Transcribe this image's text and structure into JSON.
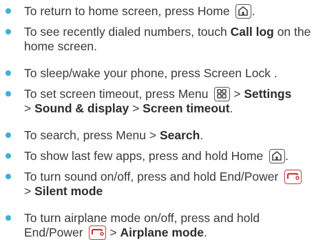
{
  "items": [
    {
      "t": "To return to home screen, press Home"
    },
    {
      "a": "To see recently dialed numbers, touch ",
      "b": "Call log",
      "c": " on the home screen."
    },
    {
      "t": "To sleep/wake your phone, press Screen Lock ."
    },
    {
      "a": "To set screen timeout, press Menu",
      "s1": " > ",
      "b1": "Settings",
      "l2": "> ",
      "b2": "Sound & display",
      "s2": " > ",
      "b3": "Screen timeout",
      "e": "."
    },
    {
      "a": "To search, press Menu > ",
      "b": "Search",
      "c": "."
    },
    {
      "t": "To show last few apps, press and hold Home"
    },
    {
      "a": "To turn sound on/off, press and hold End/Power",
      "l2": "> ",
      "b": "Silent mode"
    },
    {
      "a": "To turn airplane mode on/off, press and hold",
      "l2": "End/Power",
      "s": " > ",
      "b": "Airplane mode",
      "e": "."
    }
  ],
  "icons": {
    "home": "home-icon",
    "menu": "menu-icon",
    "end": "end-power-icon"
  },
  "colors": {
    "bullet": "#3ab0d8",
    "end_key": "#c8373b"
  }
}
